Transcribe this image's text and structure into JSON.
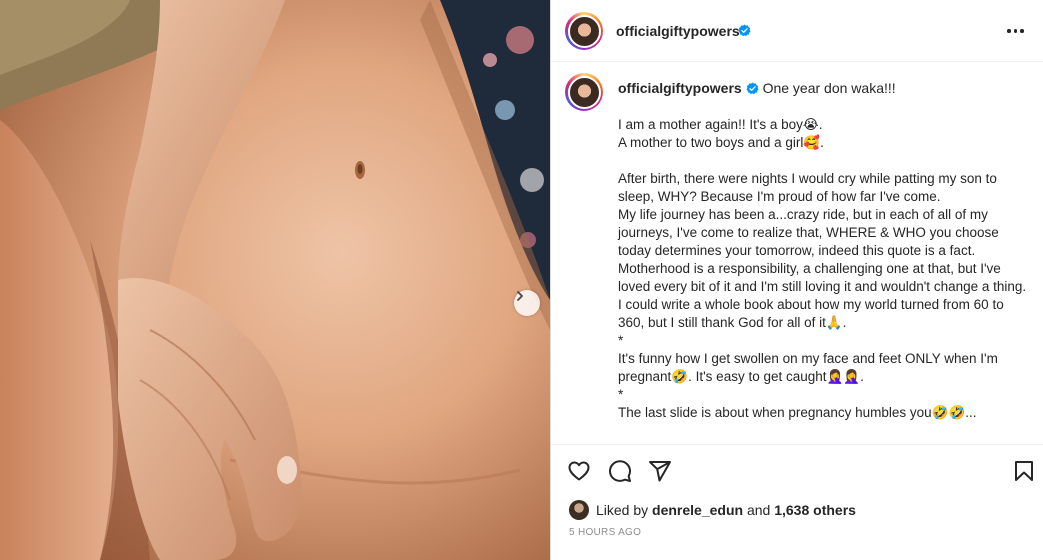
{
  "post": {
    "username": "officialgiftypowers",
    "caption_title": "One year don waka!!!",
    "caption_lines": [
      "I am a mother again!! It's a boy😭.",
      "A mother to two boys and a girl🥰.",
      "",
      "After birth, there were nights I would cry while patting my son to sleep, WHY? Because I'm proud of how far I've come.",
      "My life journey has been a...crazy ride, but in each of all of my journeys, I've come to realize that, WHERE & WHO you choose today determines your tomorrow, indeed this quote is a fact.",
      "Motherhood is a responsibility, a challenging one at that, but I've loved every bit of it and I'm still loving it and wouldn't change a thing.",
      "I could write a whole book about how my world turned from 60 to 360, but I still thank God for all of it🙏.",
      "*",
      "It's funny how I get swollen on my face and feet ONLY when I'm pregnant🤣. It's easy to get caught🤦‍♀️🤦‍♀️.",
      "*",
      "The last slide is about when pregnancy humbles you🤣🤣..."
    ],
    "liked_by_prefix": "Liked by",
    "liked_by_user": "denrele_edun",
    "liked_by_and": "and",
    "liked_by_others": "1,638 others",
    "timestamp": "5 HOURS AGO"
  },
  "icons": {
    "verified": "verified-badge-icon",
    "more": "more-options-icon",
    "next": "chevron-right-icon",
    "like": "heart-icon",
    "comment": "comment-icon",
    "share": "paper-plane-icon",
    "save": "bookmark-icon"
  },
  "colors": {
    "verified_blue": "#0095f6",
    "text": "#262626",
    "muted": "#8e8e8e",
    "skin": "#d99a71",
    "dress": "#1f2a3a"
  }
}
